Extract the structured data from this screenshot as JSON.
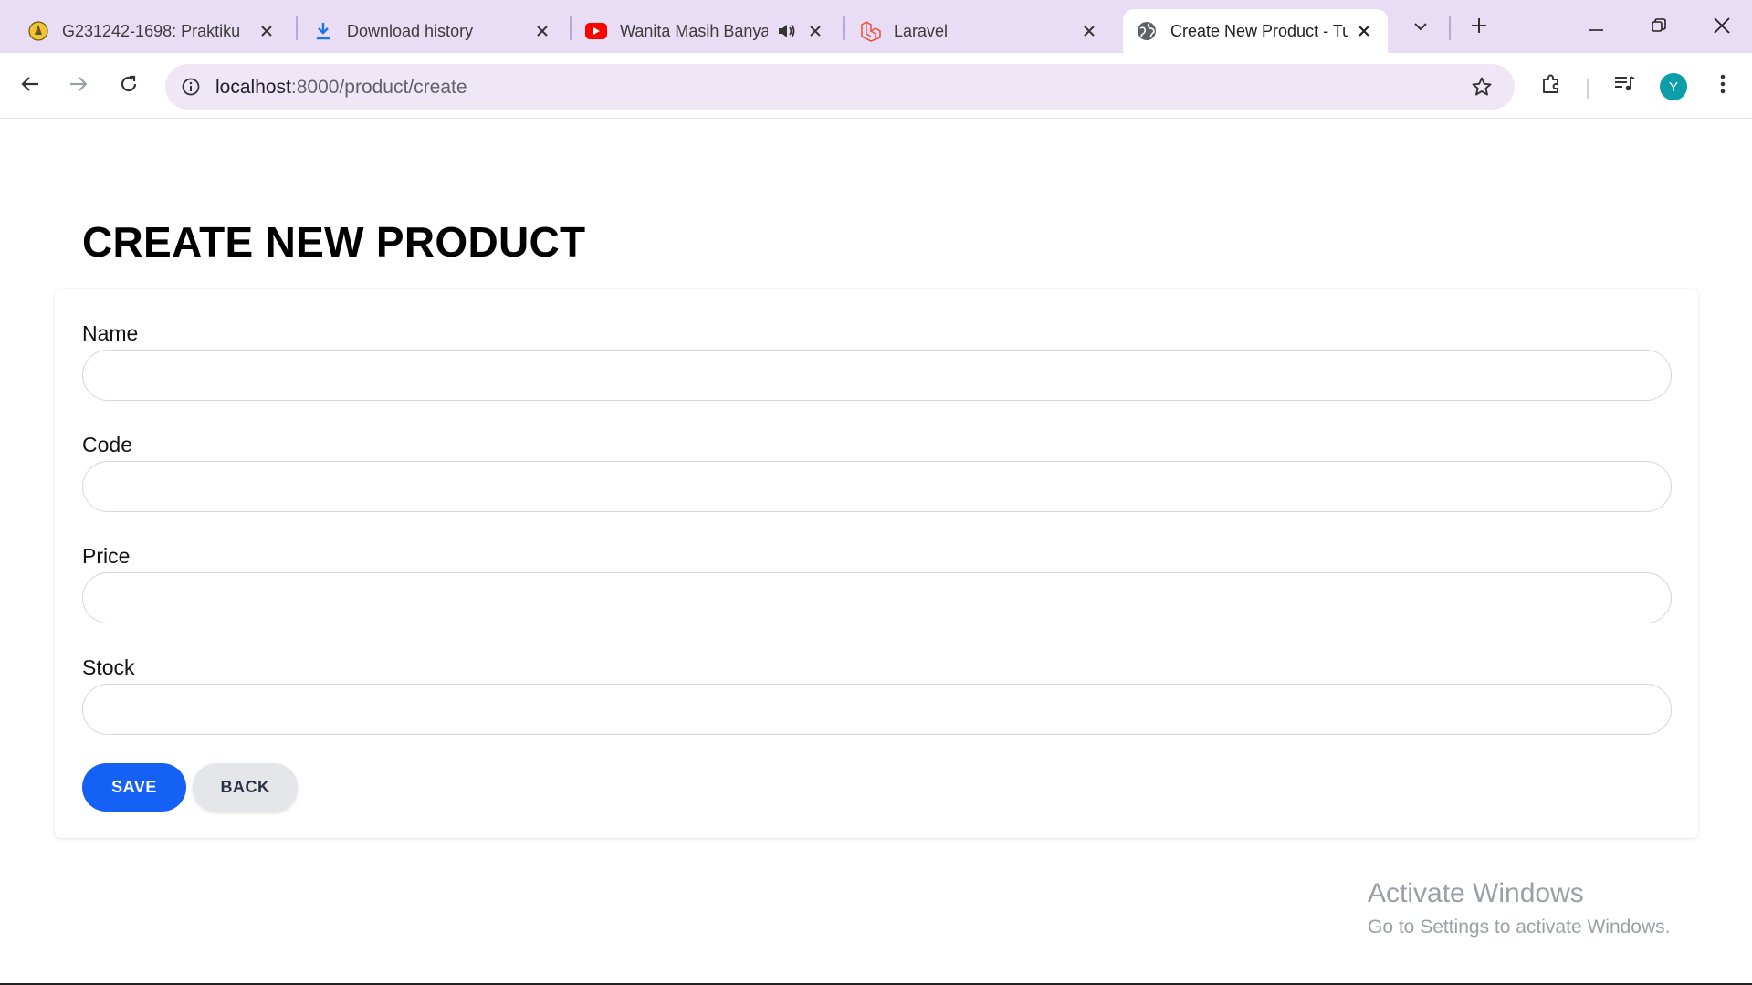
{
  "browser": {
    "tabs": [
      {
        "title": "G231242-1698: Praktiku",
        "icon": "university-crest-icon"
      },
      {
        "title": "Download history",
        "icon": "download-icon"
      },
      {
        "title": "Wanita Masih Banya",
        "icon": "youtube-icon",
        "audio": "speaker-icon"
      },
      {
        "title": "Laravel",
        "icon": "laravel-icon"
      },
      {
        "title": "Create New Product - Tu",
        "icon": "globe-icon",
        "active": true
      }
    ],
    "url_host": "localhost",
    "url_path": ":8000/product/create",
    "profile_initial": "Y",
    "accent": "#e9dcf5",
    "avatar_color": "#0d9ea9"
  },
  "page": {
    "title": "CREATE NEW PRODUCT",
    "form": {
      "fields": [
        {
          "label": "Name",
          "value": "",
          "placeholder": ""
        },
        {
          "label": "Code",
          "value": "",
          "placeholder": ""
        },
        {
          "label": "Price",
          "value": "",
          "placeholder": ""
        },
        {
          "label": "Stock",
          "value": "",
          "placeholder": ""
        }
      ],
      "save_label": "SAVE",
      "back_label": "BACK",
      "save_color": "#1560f5"
    }
  },
  "watermark": {
    "line1": "Activate Windows",
    "line2": "Go to Settings to activate Windows."
  }
}
